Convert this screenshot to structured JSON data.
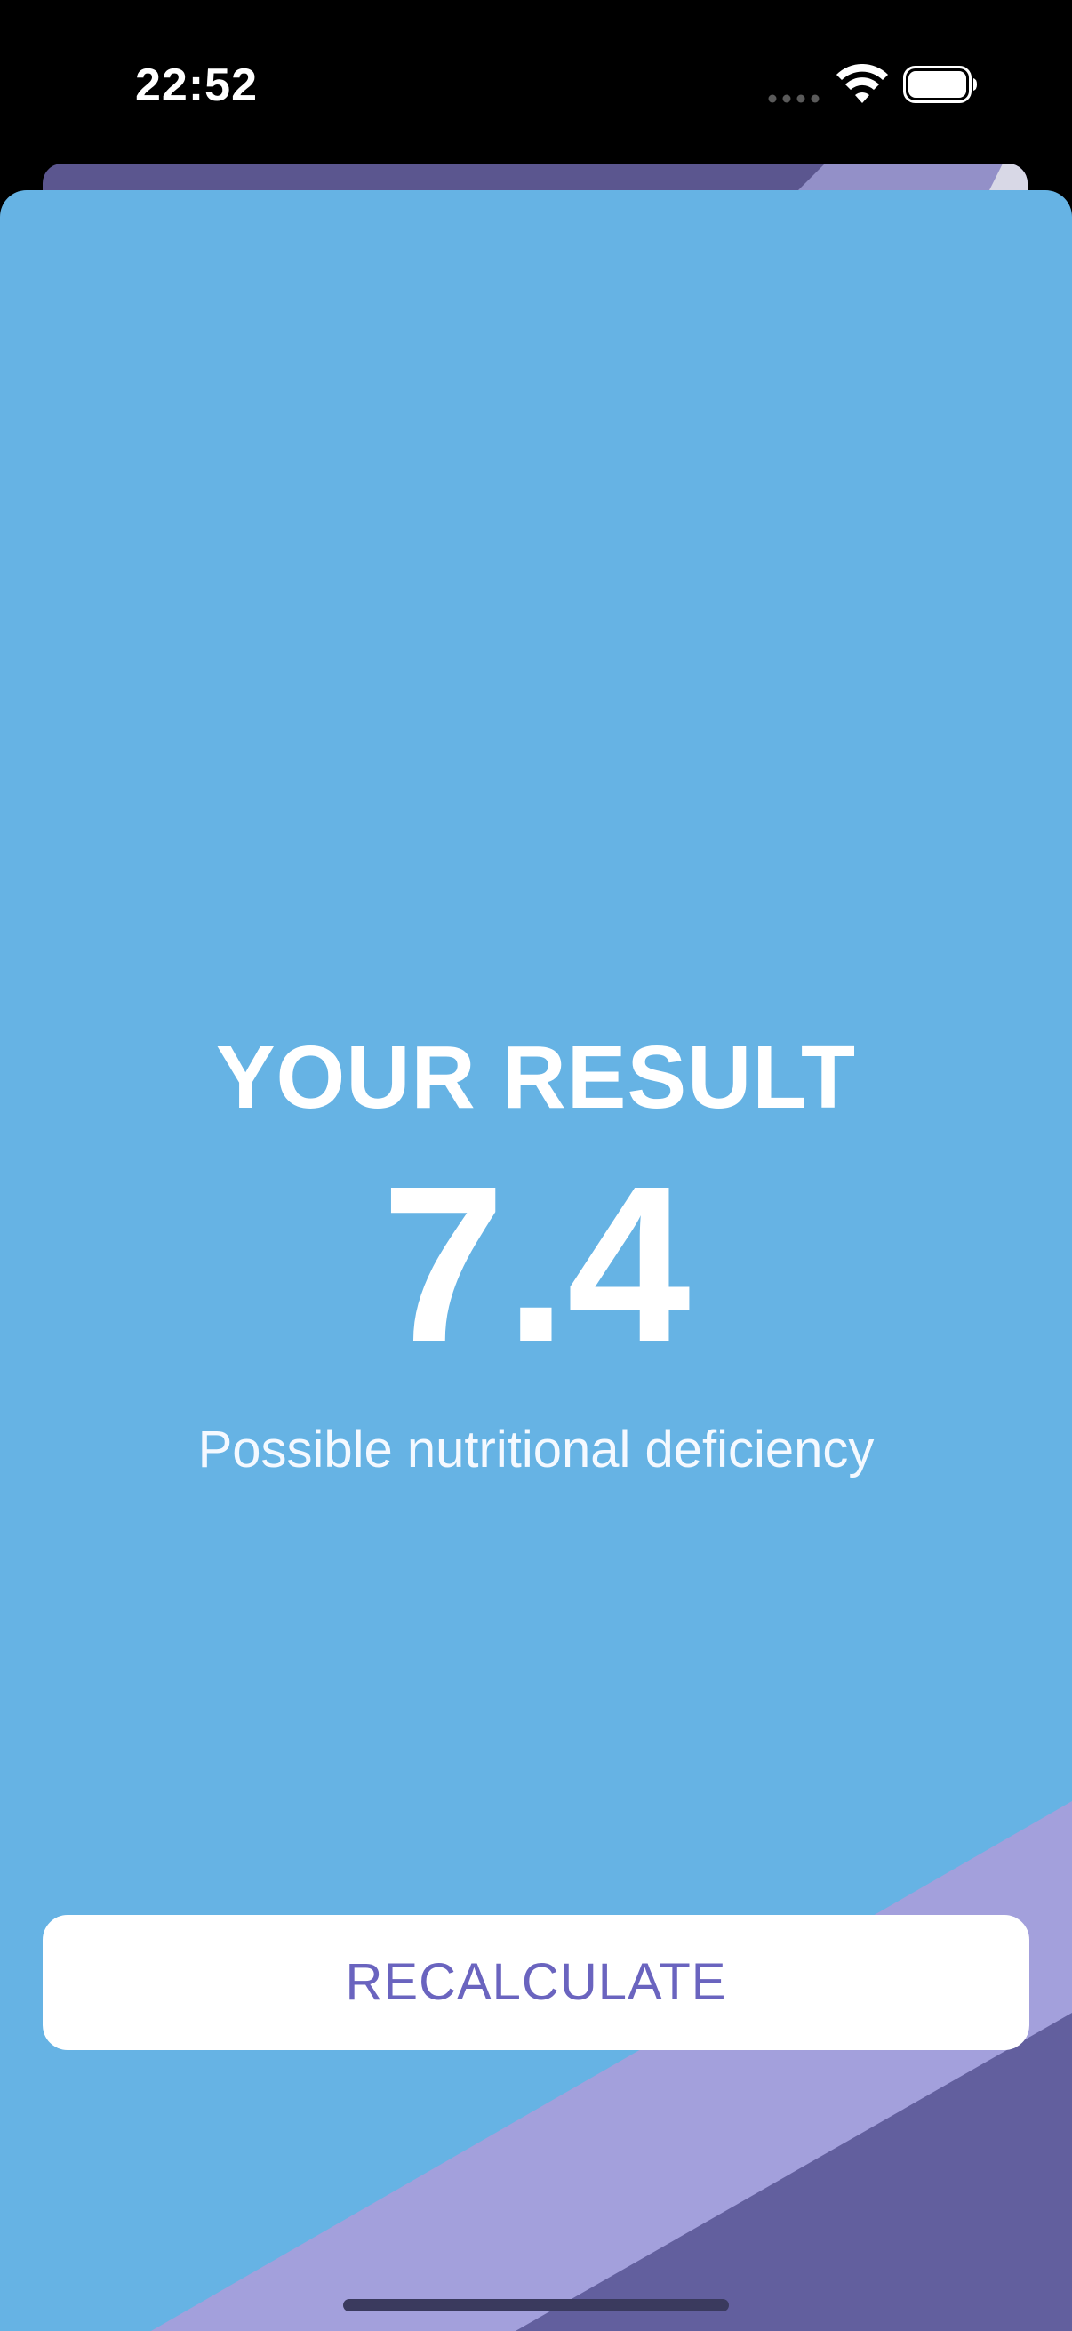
{
  "status_bar": {
    "time": "22:52",
    "icons": [
      "signal-dots-icon",
      "wifi-icon",
      "battery-icon"
    ]
  },
  "result": {
    "title": "YOUR RESULT",
    "value": "7.4",
    "message": "Possible nutritional deficiency"
  },
  "actions": {
    "recalculate_label": "RECALCULATE"
  },
  "colors": {
    "sheet_background": "#66b3e4",
    "stripe_light": "#a3a0dc",
    "stripe_dark": "#625f9e",
    "button_text": "#6a64bf",
    "button_background": "#ffffff"
  }
}
